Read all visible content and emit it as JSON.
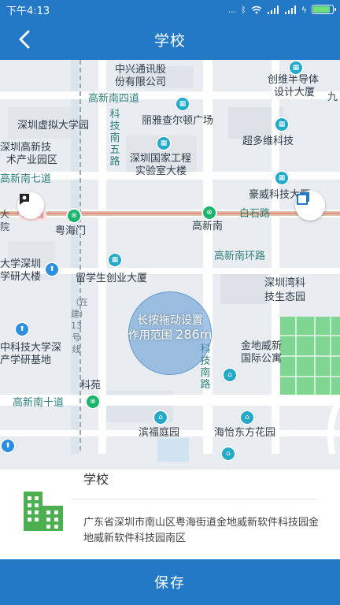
{
  "status_bar": {
    "time": "下午4:13",
    "dots": "...",
    "battery_level": 0.9,
    "battery_color": "#6fe07a"
  },
  "header": {
    "title": "学校",
    "back_icon": "chevron-left-icon",
    "background": "#2379c5"
  },
  "map": {
    "labels": {
      "zte_1": "中兴通讯股",
      "zte_2": "份有限公司",
      "chuangwei_1": "创维半导体",
      "chuangwei_2": "设计大厦",
      "gaoxin_s4": "高新南四道",
      "ritz": "丽雅查尔顿广场",
      "virtual_uni": "深圳虚拟大学园",
      "gaoxinji_1": "深圳高新技",
      "gaoxinji_2": "术产业园区",
      "keji_s5": "科技南五路",
      "national_lab_1": "深圳国家工程",
      "national_lab_2": "实验室大楼",
      "chaoduowei": "超多维科技",
      "gaoxin_s7": "高新南七道",
      "haowei": "豪威科技大厦",
      "line9": "9号线",
      "yuehaimen": "粤海门",
      "gaoxinnan": "高新南",
      "baishilu": "白石路",
      "gaoxin_ring": "高新南环路",
      "uni_shenzhen_1": "大学深圳",
      "uni_shenzhen_2": "学研大楼",
      "students": "留学生创业大厦",
      "bay_1": "深圳湾科",
      "bay_2": "技生态园",
      "hkust_1": "中科技大学深",
      "hkust_2": "产学研基地",
      "keji_s": "科技南路",
      "jindi_1": "金地威新",
      "jindi_2": "国际公寓",
      "keyuan": "科苑",
      "gaoxin_s10": "高新南十道",
      "binfu": "滨福庭园",
      "haiyi": "海怡东方花园",
      "line13": "（在建）13号线",
      "edge_left_1": "大",
      "edge_left_2": "院",
      "edge_right": "九"
    },
    "accuracy_line1": "长按拖动设置",
    "accuracy_line2": "作用范围",
    "accuracy_radius": "286m",
    "locate_icon": "locate-frame-icon",
    "destination_icon": "destination-pin-icon"
  },
  "info_panel": {
    "place_name": "学校",
    "address": "广东省深圳市南山区粤海街道金地威新软件科技园金地威新软件科技园南区",
    "icon": "building-icon",
    "icon_color": "#4caf50"
  },
  "footer": {
    "save_label": "保存"
  }
}
